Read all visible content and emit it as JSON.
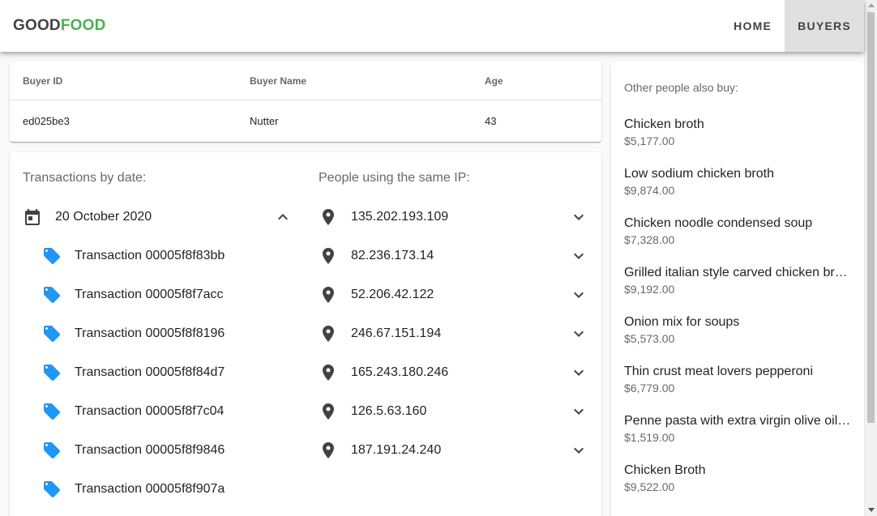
{
  "header": {
    "logo_part1": "GOOD",
    "logo_part2": "FOOD",
    "nav": [
      {
        "label": "HOME",
        "active": false
      },
      {
        "label": "BUYERS",
        "active": true
      }
    ]
  },
  "buyer_table": {
    "columns": [
      "Buyer ID",
      "Buyer Name",
      "Age"
    ],
    "row": [
      "ed025be3",
      "Nutter",
      "43"
    ]
  },
  "transactions": {
    "title": "Transactions by date:",
    "date_icon": "calendar-icon",
    "date": "20 October 2020",
    "expanded": true,
    "item_icon": "tag-icon",
    "items": [
      "Transaction 00005f8f83bb",
      "Transaction 00005f8f7acc",
      "Transaction 00005f8f8196",
      "Transaction 00005f8f84d7",
      "Transaction 00005f8f7c04",
      "Transaction 00005f8f9846",
      "Transaction 00005f8f907a"
    ]
  },
  "same_ip": {
    "title": "People using the same IP:",
    "item_icon": "location-pin-icon",
    "ips": [
      "135.202.193.109",
      "82.236.173.14",
      "52.206.42.122",
      "246.67.151.194",
      "165.243.180.246",
      "126.5.63.160",
      "187.191.24.240"
    ]
  },
  "recommendations": {
    "subtitle": "Other people also buy:",
    "products": [
      {
        "name": "Chicken broth",
        "price": "$5,177.00"
      },
      {
        "name": "Low sodium chicken broth",
        "price": "$9,874.00"
      },
      {
        "name": "Chicken noodle condensed soup",
        "price": "$7,328.00"
      },
      {
        "name": "Grilled italian style carved chicken breast",
        "price": "$9,192.00"
      },
      {
        "name": "Onion mix for soups",
        "price": "$5,573.00"
      },
      {
        "name": "Thin crust meat lovers pepperoni",
        "price": "$6,779.00"
      },
      {
        "name": "Penne pasta with extra virgin olive oil and garlic",
        "price": "$1,519.00"
      },
      {
        "name": "Chicken Broth",
        "price": "$9,522.00"
      }
    ]
  },
  "colors": {
    "brand_green": "#4caf50",
    "tag_blue": "#2196f3",
    "icon_dark": "#424242"
  }
}
